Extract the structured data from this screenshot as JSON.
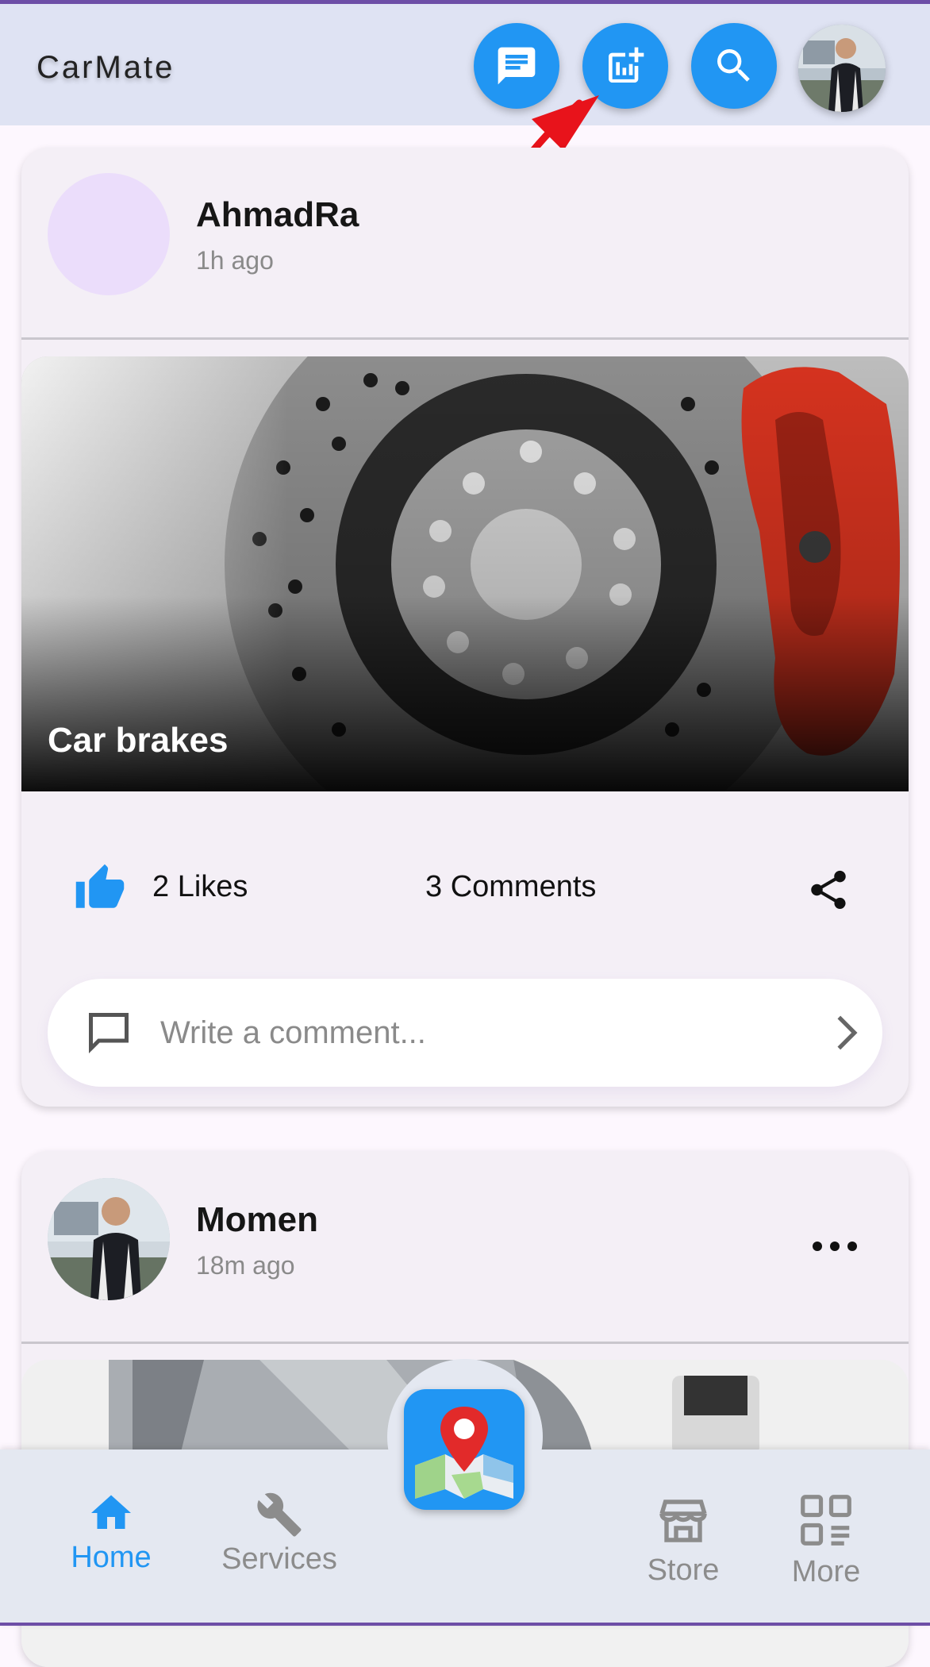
{
  "app": {
    "title": "CarMate"
  },
  "header_actions": [
    {
      "name": "messages",
      "icon": "chat-icon"
    },
    {
      "name": "polls",
      "icon": "add-chart-icon"
    },
    {
      "name": "search",
      "icon": "search-icon"
    },
    {
      "name": "profile",
      "icon": "avatar"
    }
  ],
  "posts": [
    {
      "author": "AhmadRa",
      "time": "1h ago",
      "caption": "Car brakes",
      "likes": "2 Likes",
      "comments": "3 Comments",
      "comment_placeholder": "Write a comment..."
    },
    {
      "author": "Momen",
      "time": "18m ago"
    }
  ],
  "bottom_nav": {
    "items": [
      {
        "label": "Home",
        "icon": "home-icon",
        "active": true
      },
      {
        "label": "Services",
        "icon": "wrench-icon",
        "active": false
      },
      {
        "label": "Store",
        "icon": "store-icon",
        "active": false
      },
      {
        "label": "More",
        "icon": "grid-icon",
        "active": false
      }
    ],
    "center_action_icon": "map-icon"
  },
  "colors": {
    "accent": "#2196f3",
    "app_bar": "#dfe3f3",
    "background": "#fdf7fe",
    "card": "#f4eff6",
    "nav_inactive": "#8c8c8c",
    "annotation": "#e8131b"
  }
}
